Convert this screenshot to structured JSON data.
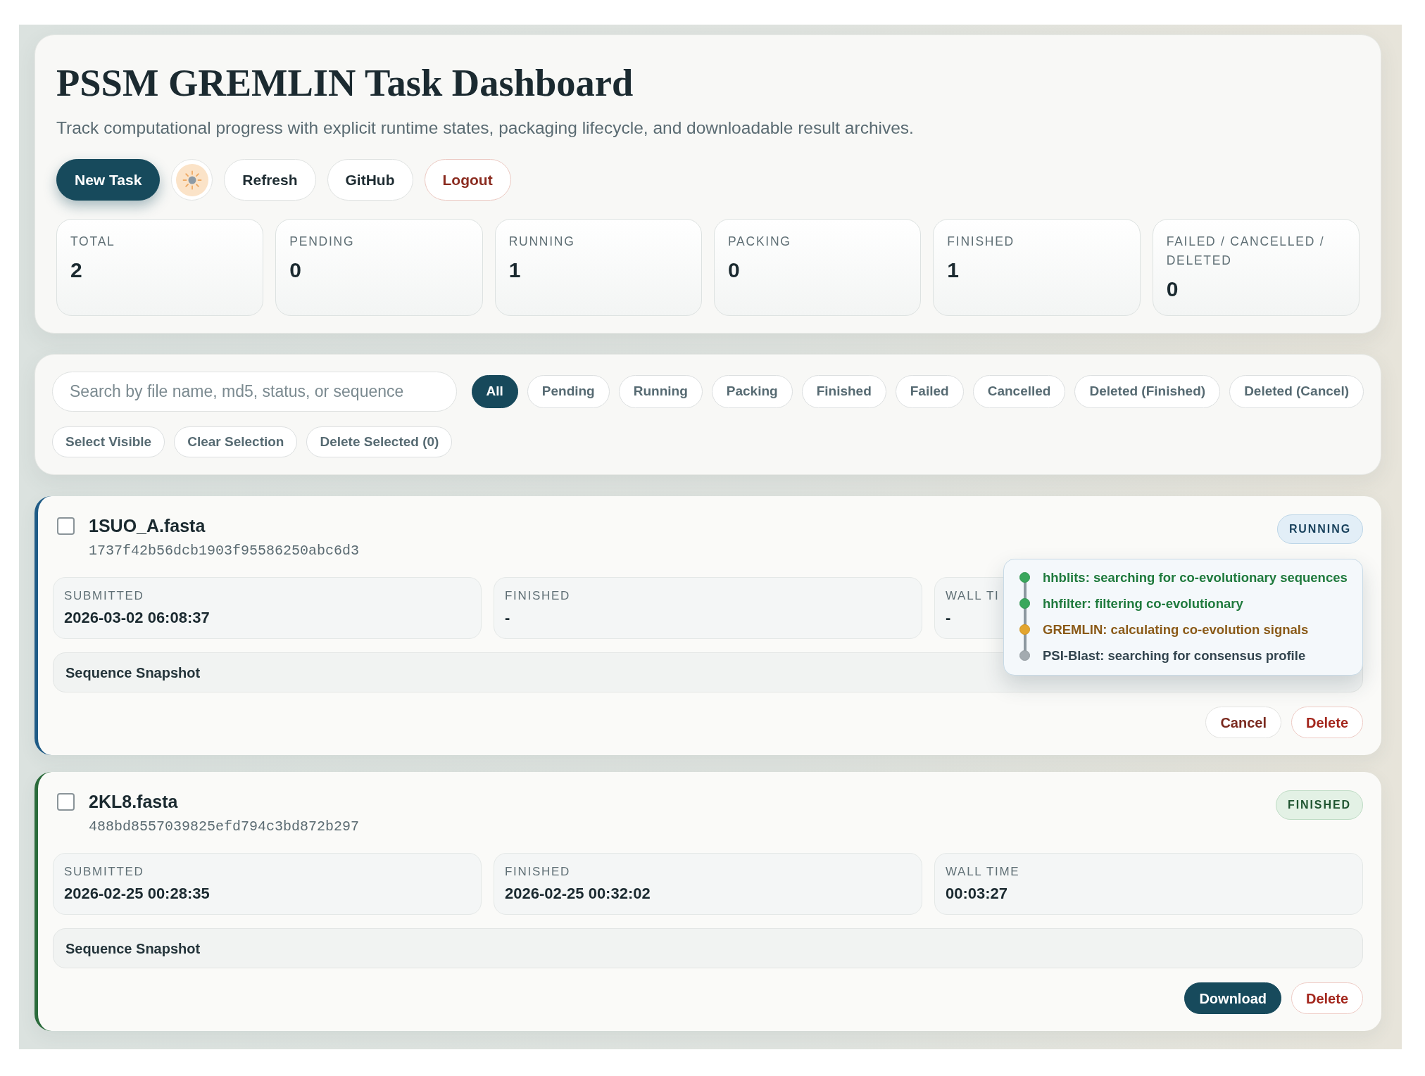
{
  "header": {
    "title": "PSSM GREMLIN Task Dashboard",
    "subtitle": "Track computational progress with explicit runtime states, packaging lifecycle, and downloadable result archives.",
    "buttons": [
      {
        "kind": "primary",
        "label": "New Task"
      },
      {
        "kind": "theme"
      },
      {
        "kind": "plain",
        "label": "Refresh"
      },
      {
        "kind": "plain",
        "label": "GitHub"
      },
      {
        "kind": "danger",
        "label": "Logout"
      }
    ],
    "stats": [
      {
        "label": "TOTAL",
        "value": "2"
      },
      {
        "label": "PENDING",
        "value": "0"
      },
      {
        "label": "RUNNING",
        "value": "1"
      },
      {
        "label": "PACKING",
        "value": "0"
      },
      {
        "label": "FINISHED",
        "value": "1"
      },
      {
        "label": "FAILED / CANCELLED / DELETED",
        "value": "0"
      }
    ]
  },
  "filters": {
    "search": {
      "placeholder": "Search by file name, md5, status, or sequence"
    },
    "status_chips": [
      {
        "label": "All",
        "selected": true
      },
      {
        "label": "Pending",
        "selected": false
      },
      {
        "label": "Running",
        "selected": false
      },
      {
        "label": "Packing",
        "selected": false
      },
      {
        "label": "Finished",
        "selected": false
      },
      {
        "label": "Failed",
        "selected": false
      },
      {
        "label": "Cancelled",
        "selected": false
      },
      {
        "label": "Deleted (Finished)",
        "selected": false
      },
      {
        "label": "Deleted (Cancel)",
        "selected": false
      }
    ],
    "selection_buttons": [
      "Select Visible",
      "Clear Selection",
      "Delete Selected (0)"
    ]
  },
  "tasks": [
    {
      "kind": "running",
      "checked": false,
      "file_name": "1SUO_A.fasta",
      "md5": "1737f42b56dcb1903f95586250abc6d3",
      "status": "RUNNING",
      "details": [
        {
          "label": "SUBMITTED",
          "value": "2026-03-02 06:08:37"
        },
        {
          "label": "FINISHED",
          "value": "-"
        },
        {
          "label": "WALL TI",
          "value": "-"
        }
      ],
      "snapshot": "Sequence Snapshot",
      "progress_steps": [
        {
          "kind": "done",
          "label": "hhblits: searching for co-evolutionary sequences"
        },
        {
          "kind": "done",
          "label": "hhfilter: filtering co-evolutionary"
        },
        {
          "kind": "active",
          "label": "GREMLIN: calculating co-evolution signals"
        },
        {
          "kind": "pending",
          "label": "PSI-Blast: searching for consensus profile"
        }
      ],
      "actions": [
        {
          "kind": "cancel",
          "label": "Cancel"
        },
        {
          "kind": "delete",
          "label": "Delete"
        }
      ]
    },
    {
      "kind": "finished",
      "checked": false,
      "file_name": "2KL8.fasta",
      "md5": "488bd8557039825efd794c3bd872b297",
      "status": "FINISHED",
      "details": [
        {
          "label": "SUBMITTED",
          "value": "2026-02-25 00:28:35"
        },
        {
          "label": "FINISHED",
          "value": "2026-02-25 00:32:02"
        },
        {
          "label": "WALL TIME",
          "value": "00:03:27"
        }
      ],
      "snapshot": "Sequence Snapshot",
      "actions": [
        {
          "kind": "download",
          "label": "Download"
        },
        {
          "kind": "delete",
          "label": "Delete"
        }
      ]
    }
  ]
}
